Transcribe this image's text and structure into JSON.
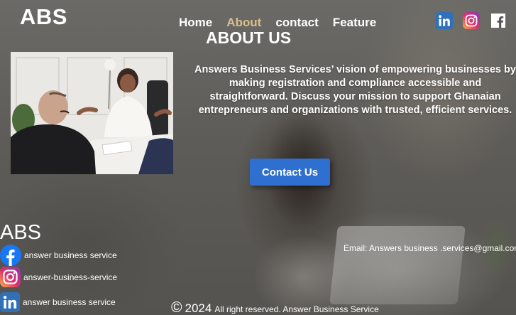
{
  "brand": {
    "logo": "ABS"
  },
  "nav": {
    "items": [
      {
        "label": "Home",
        "active": false
      },
      {
        "label": "About",
        "active": true
      },
      {
        "label": "contact",
        "active": false
      },
      {
        "label": "Feature",
        "active": false
      }
    ]
  },
  "social_top": [
    "linkedin-icon",
    "instagram-icon",
    "facebook-icon"
  ],
  "about": {
    "title": "ABOUT US",
    "text": "Answers Business Services’ vision of empowering businesses by making registration and compliance accessible and straightforward. Discuss your mission to support Ghanaian entrepreneurs and organizations with trusted, efficient services.",
    "button_label": "Contact Us"
  },
  "footer": {
    "logo": "ABS",
    "links": [
      {
        "icon": "facebook-icon",
        "label": "answer business service"
      },
      {
        "icon": "instagram-icon",
        "label": "answer-business-service"
      },
      {
        "icon": "linkedin-icon",
        "label": "answer business service"
      }
    ],
    "email": "Email: Answers business .services@gmail.com",
    "copyright_symbol": "©",
    "year": "2024",
    "rights": "All right reserved. Answer Business Service"
  },
  "colors": {
    "accent_nav": "#d9c08a",
    "button": "#2f6fcf",
    "linkedin": "#2f70b8",
    "facebook": "#1877f2"
  }
}
